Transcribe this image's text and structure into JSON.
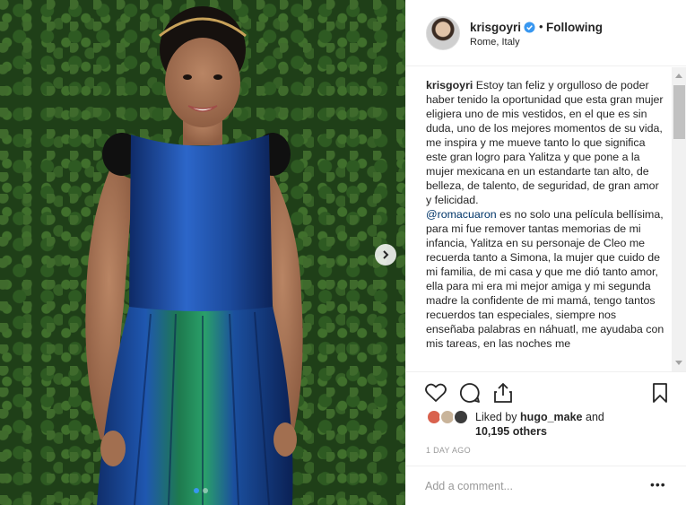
{
  "post": {
    "image_alt": "Woman in a metallic blue and green dress against a green hedge",
    "carousel": {
      "slide_count": 2,
      "active_slide": 1
    }
  },
  "header": {
    "username": "krisgoyri",
    "verified": true,
    "separator": "•",
    "follow_status": "Following",
    "location": "Rome, Italy"
  },
  "caption": {
    "username": "krisgoyri",
    "text_part1": "Estoy tan feliz y orgulloso de poder haber tenido la oportunidad que esta gran mujer eligiera uno de mis vestidos, en el que es sin duda, uno de los mejores momentos de su vida, me inspira y me mueve tanto lo que significa este gran logro para Yalitza y que pone a la mujer mexicana en un estandarte tan alto, de belleza, de talento, de seguridad, de gran amor y felicidad.",
    "mention": "@romacuaron",
    "text_part2": "es no solo una película bellísima, para mi fue remover tantas memorias de mi infancia, Yalitza en su personaje de Cleo me recuerda tanto a Simona, la mujer que cuido de mi familia, de mi casa y que me dió tanto amor, ella para mi era mi mejor amiga y mi segunda madre la confidente de mi mamá, tengo tantos recuerdos tan especiales, siempre nos enseñaba palabras en náhuatl, me ayudaba con mis tareas, en las noches me"
  },
  "likes": {
    "prefix": "Liked by",
    "first_liker": "hugo_make",
    "conjunction": "and",
    "others": "10,195 others"
  },
  "timestamp": "1 DAY AGO",
  "comment": {
    "placeholder": "Add a comment..."
  },
  "more_options": "•••",
  "colors": {
    "verified_blue": "#3897f0",
    "link": "#003569",
    "dress_blue": "#1c4a9c",
    "dress_green": "#1e7a4e",
    "hedge": "#1f3f18"
  }
}
